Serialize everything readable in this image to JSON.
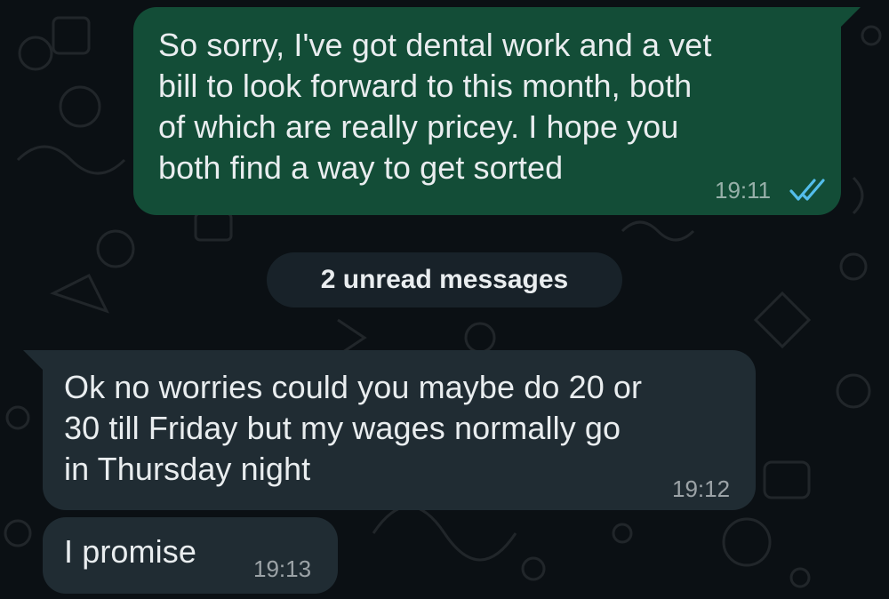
{
  "theme": {
    "background": "#0b1014",
    "outgoing_bubble": "#134d37",
    "incoming_bubble": "#202c33",
    "read_tick_color": "#53bdeb"
  },
  "messages": [
    {
      "direction": "outgoing",
      "text": "So sorry, I've got dental work and a vet\nbill to look forward to this month, both\nof which are really pricey. I hope you\nboth find a way to get sorted",
      "time": "19:11",
      "status_icon": "double-check-read-icon"
    },
    {
      "direction": "incoming",
      "text": "Ok no worries could you maybe do 20 or\n30 till Friday but my wages normally go\nin Thursday night",
      "time": "19:12"
    },
    {
      "direction": "incoming",
      "text": "I promise",
      "time": "19:13"
    }
  ],
  "unread_divider": {
    "label": "2 unread messages"
  }
}
